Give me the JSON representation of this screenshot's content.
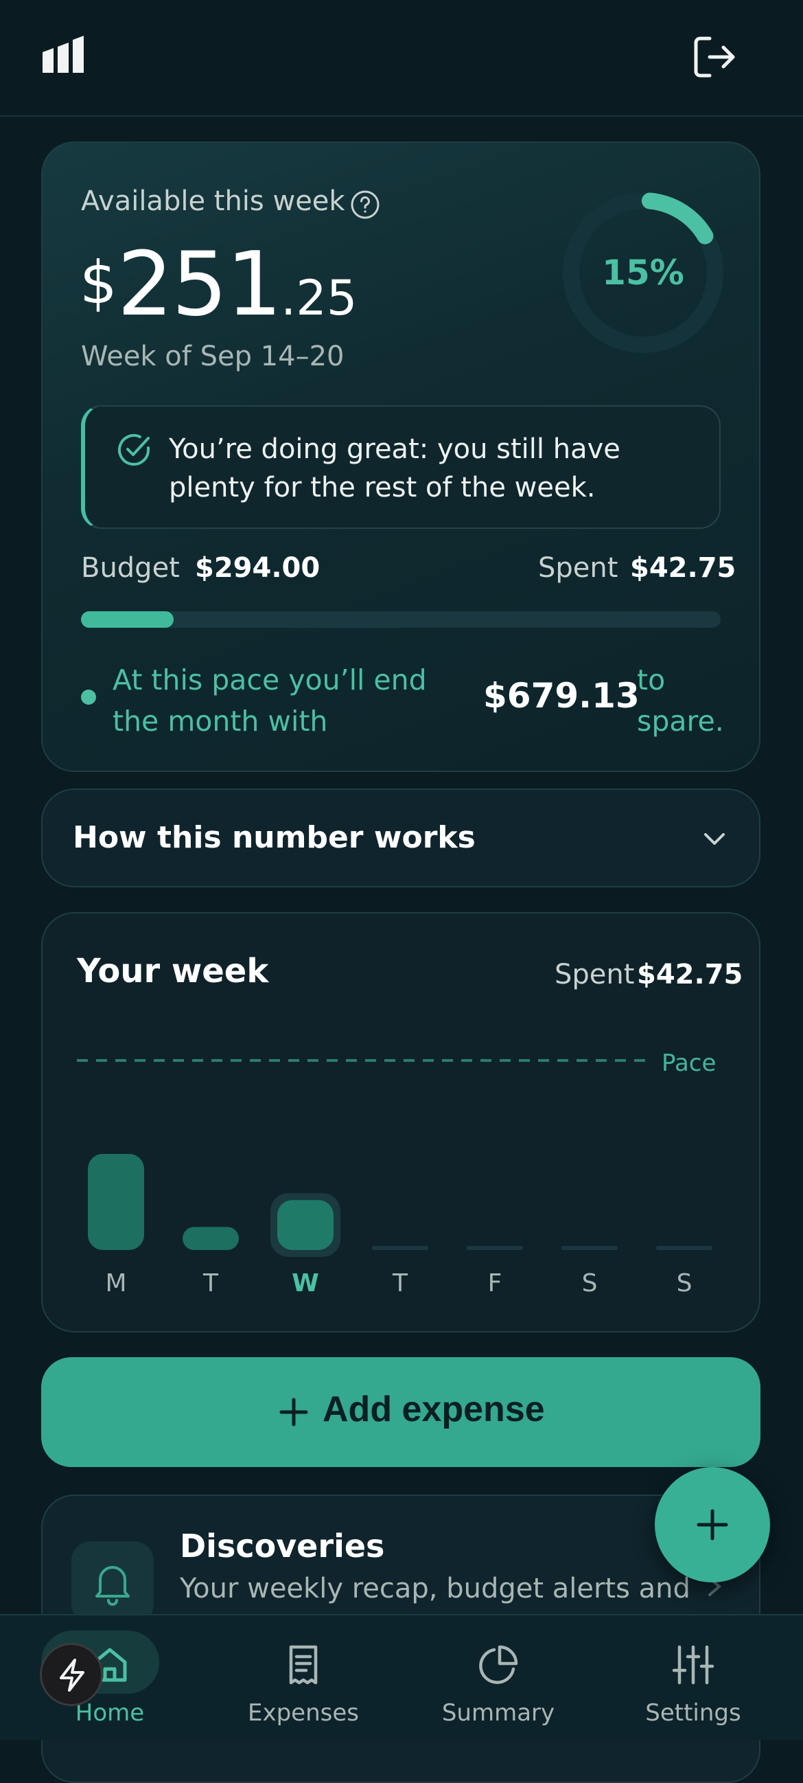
{
  "icons": {
    "logo": "bar-logo-icon",
    "logout": "logout-icon",
    "help": "question-circle-icon",
    "check": "check-circle-icon",
    "chevron": "chevron-down-icon",
    "plus": "plus-icon",
    "bell": "bell-icon",
    "arrow": "chevron-right-icon",
    "bolt": "bolt-icon"
  },
  "colors": {
    "background": "#0a1b22",
    "accent": "#4cc0a2",
    "button": "#35a890"
  },
  "hero": {
    "label": "Available this week",
    "currency": "$",
    "amount_whole": "251",
    "amount_cents": ".25",
    "week_of": "Week of Sep 14–20",
    "ring_label": "15%",
    "ring_fraction": 0.15,
    "callout": "You’re doing great: you still have plenty for the rest of the week.",
    "budget_label": "Budget",
    "budget_value": "$294.00",
    "spent_label": "Spent",
    "spent_value": "$42.75",
    "progress_fraction": 0.145,
    "pace_text": "At this pace you’ll end the month with",
    "pace_amount": "$679.13",
    "pace_suffix": "to spare."
  },
  "how": {
    "title": "How this number works"
  },
  "week": {
    "title": "Your week",
    "spent_label": "Spent",
    "spent_value": "$42.75",
    "pace_label": "Pace",
    "days": [
      "M",
      "T",
      "W",
      "T",
      "F",
      "S",
      "S"
    ],
    "active_index": 2,
    "values_relative": [
      1.0,
      0.24,
      0.52,
      0,
      0,
      0,
      0
    ]
  },
  "actions": {
    "add_expense": "Add expense"
  },
  "discoveries": {
    "title": "Discoveries",
    "subtitle": "Your weekly recap, budget alerts and"
  },
  "nav": {
    "items": [
      {
        "label": "Home",
        "icon": "home-icon"
      },
      {
        "label": "Expenses",
        "icon": "receipt-icon"
      },
      {
        "label": "Summary",
        "icon": "pie-chart-icon"
      },
      {
        "label": "Settings",
        "icon": "sliders-icon"
      }
    ],
    "active": 0
  }
}
